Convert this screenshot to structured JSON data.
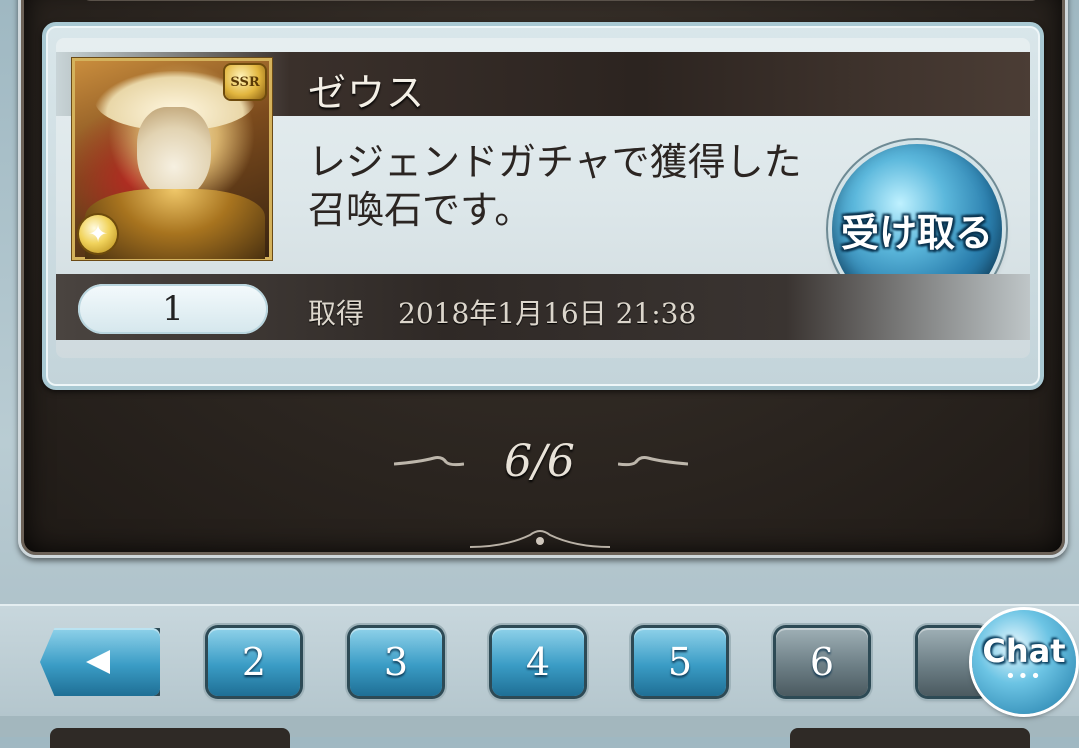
{
  "item": {
    "name": "ゼウス",
    "rarity": "SSR",
    "element_icon": "light-element-icon",
    "description": "レジェンドガチャで獲得した召喚石です。",
    "receive_label": "受け取る",
    "quantity": "1",
    "acquired_label": "取得",
    "acquired_date": "2018年1月16日 21:38"
  },
  "page_indicator": "6/6",
  "pagination": {
    "prev_icon": "left-arrow-icon",
    "pages": [
      "2",
      "3",
      "4",
      "5",
      "6"
    ],
    "current": "6"
  },
  "chat": {
    "label": "Chat",
    "dots": "•••"
  },
  "colors": {
    "frame_dark": "#2a241f",
    "button_blue": "#3a9cc5",
    "card_bg": "#dde7ea"
  }
}
